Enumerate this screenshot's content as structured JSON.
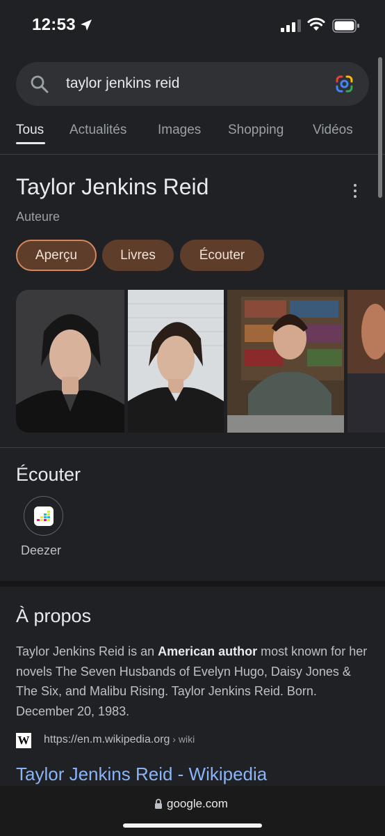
{
  "status_bar": {
    "time": "12:53",
    "icons": [
      "location-arrow-icon",
      "signal-icon",
      "wifi-icon",
      "battery-icon"
    ]
  },
  "search": {
    "query": "taylor jenkins reid",
    "left_icon": "search-icon",
    "right_icon": "google-lens-icon"
  },
  "tabs": [
    {
      "label": "Tous",
      "active": true
    },
    {
      "label": "Actualités",
      "active": false
    },
    {
      "label": "Images",
      "active": false
    },
    {
      "label": "Shopping",
      "active": false
    },
    {
      "label": "Vidéos",
      "active": false
    }
  ],
  "knowledge_panel": {
    "title": "Taylor Jenkins Reid",
    "subtitle": "Auteure",
    "chips": [
      {
        "label": "Aperçu",
        "active": true
      },
      {
        "label": "Livres",
        "active": false
      },
      {
        "label": "Écouter",
        "active": false
      }
    ]
  },
  "listen": {
    "title": "Écouter",
    "service": "Deezer"
  },
  "about": {
    "title": "À propos",
    "text_before": "Taylor Jenkins Reid is an ",
    "text_bold": "American author",
    "text_after": " most known for her novels The Seven Husbands of Evelyn Hugo, Daisy Jones & The Six, and Malibu Rising. Taylor Jenkins Reid. Born. December 20, 1983.",
    "source_icon": "W",
    "source_url": "https://en.m.wikipedia.org",
    "source_crumb": " › wiki",
    "link_title": "Taylor Jenkins Reid - Wikipedia"
  },
  "bottom_bar": {
    "domain": "google.com"
  },
  "colors": {
    "background": "#202124",
    "chip": "#5e3d2a",
    "chip_border_active": "#d4875a",
    "link": "#8ab4f8"
  }
}
